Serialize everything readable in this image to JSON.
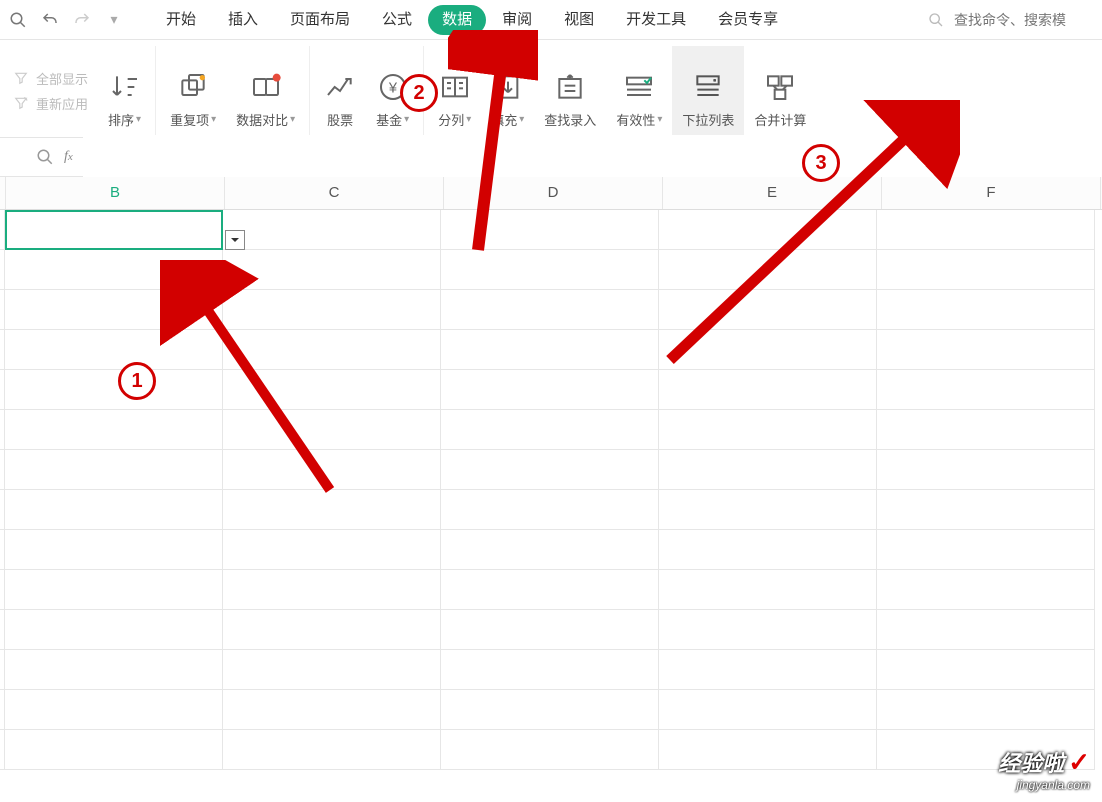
{
  "quick_access": {
    "undo": "↶",
    "redo": "↷"
  },
  "menu": {
    "tabs": [
      "开始",
      "插入",
      "页面布局",
      "公式",
      "数据",
      "审阅",
      "视图",
      "开发工具",
      "会员专享"
    ],
    "active": "数据"
  },
  "search": {
    "placeholder": "查找命令、搜索模"
  },
  "ribbon": {
    "left": {
      "show_all": "全部显示",
      "reapply": "重新应用"
    },
    "items": [
      {
        "id": "sort",
        "label": "排序",
        "dd": true,
        "split": true
      },
      {
        "id": "dup",
        "label": "重复项",
        "dd": true
      },
      {
        "id": "compare",
        "label": "数据对比",
        "dd": true,
        "split": true
      },
      {
        "id": "stock",
        "label": "股票"
      },
      {
        "id": "fund",
        "label": "基金",
        "dd": true,
        "split": true
      },
      {
        "id": "split",
        "label": "分列",
        "dd": true
      },
      {
        "id": "fill",
        "label": "填充",
        "dd": true
      },
      {
        "id": "lookup",
        "label": "查找录入"
      },
      {
        "id": "valid",
        "label": "有效性",
        "dd": true
      },
      {
        "id": "dropdown",
        "label": "下拉列表",
        "hl": true
      },
      {
        "id": "merge",
        "label": "合并计算"
      }
    ]
  },
  "formula_bar": {
    "value": ""
  },
  "columns": {
    "headers": [
      "B",
      "C",
      "D",
      "E",
      "F"
    ],
    "active": "B"
  },
  "annotations": {
    "step1": "1",
    "step2": "2",
    "step3": "3"
  },
  "watermark": {
    "line1": "经验啦",
    "line2": "jingyanla.com"
  },
  "icons": {
    "caret": "▾"
  }
}
